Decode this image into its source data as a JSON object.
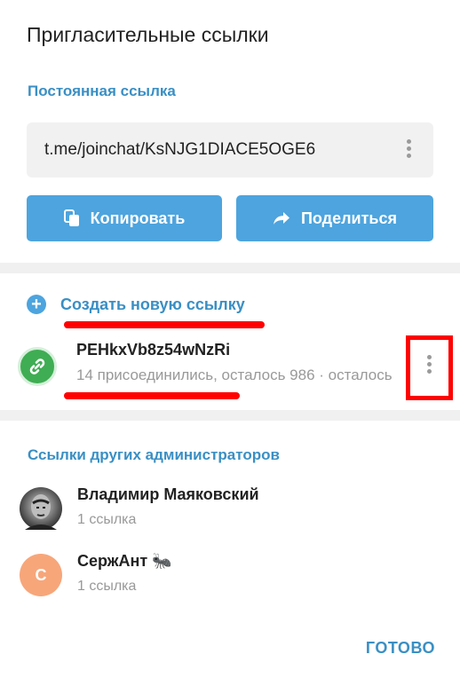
{
  "dialog": {
    "title": "Пригласительные ссылки"
  },
  "permanent": {
    "label": "Постоянная ссылка",
    "url": "t.me/joinchat/KsNJG1DIACE5OGE6",
    "copy_label": "Копировать",
    "share_label": "Поделиться"
  },
  "create": {
    "label": "Создать новую ссылку"
  },
  "invite": {
    "name": "PEHkxVb8z54wNzRi",
    "subtitle": "14 присоединились, осталось 986 · осталось"
  },
  "admins": {
    "label": "Ссылки других администраторов",
    "items": [
      {
        "name": "Владимир Маяковский",
        "count": "1 ссылка",
        "avatar": "photo"
      },
      {
        "name": "СержАнт 🐜",
        "count": "1 ссылка",
        "initial": "С",
        "avatar_color": "#f7a67a"
      }
    ]
  },
  "footer": {
    "done_label": "ГОТОВО"
  },
  "colors": {
    "accent": "#4da4de",
    "link_text": "#3a8fc4",
    "annotation_red": "#ff0000",
    "link_icon_green": "#3fad53"
  }
}
